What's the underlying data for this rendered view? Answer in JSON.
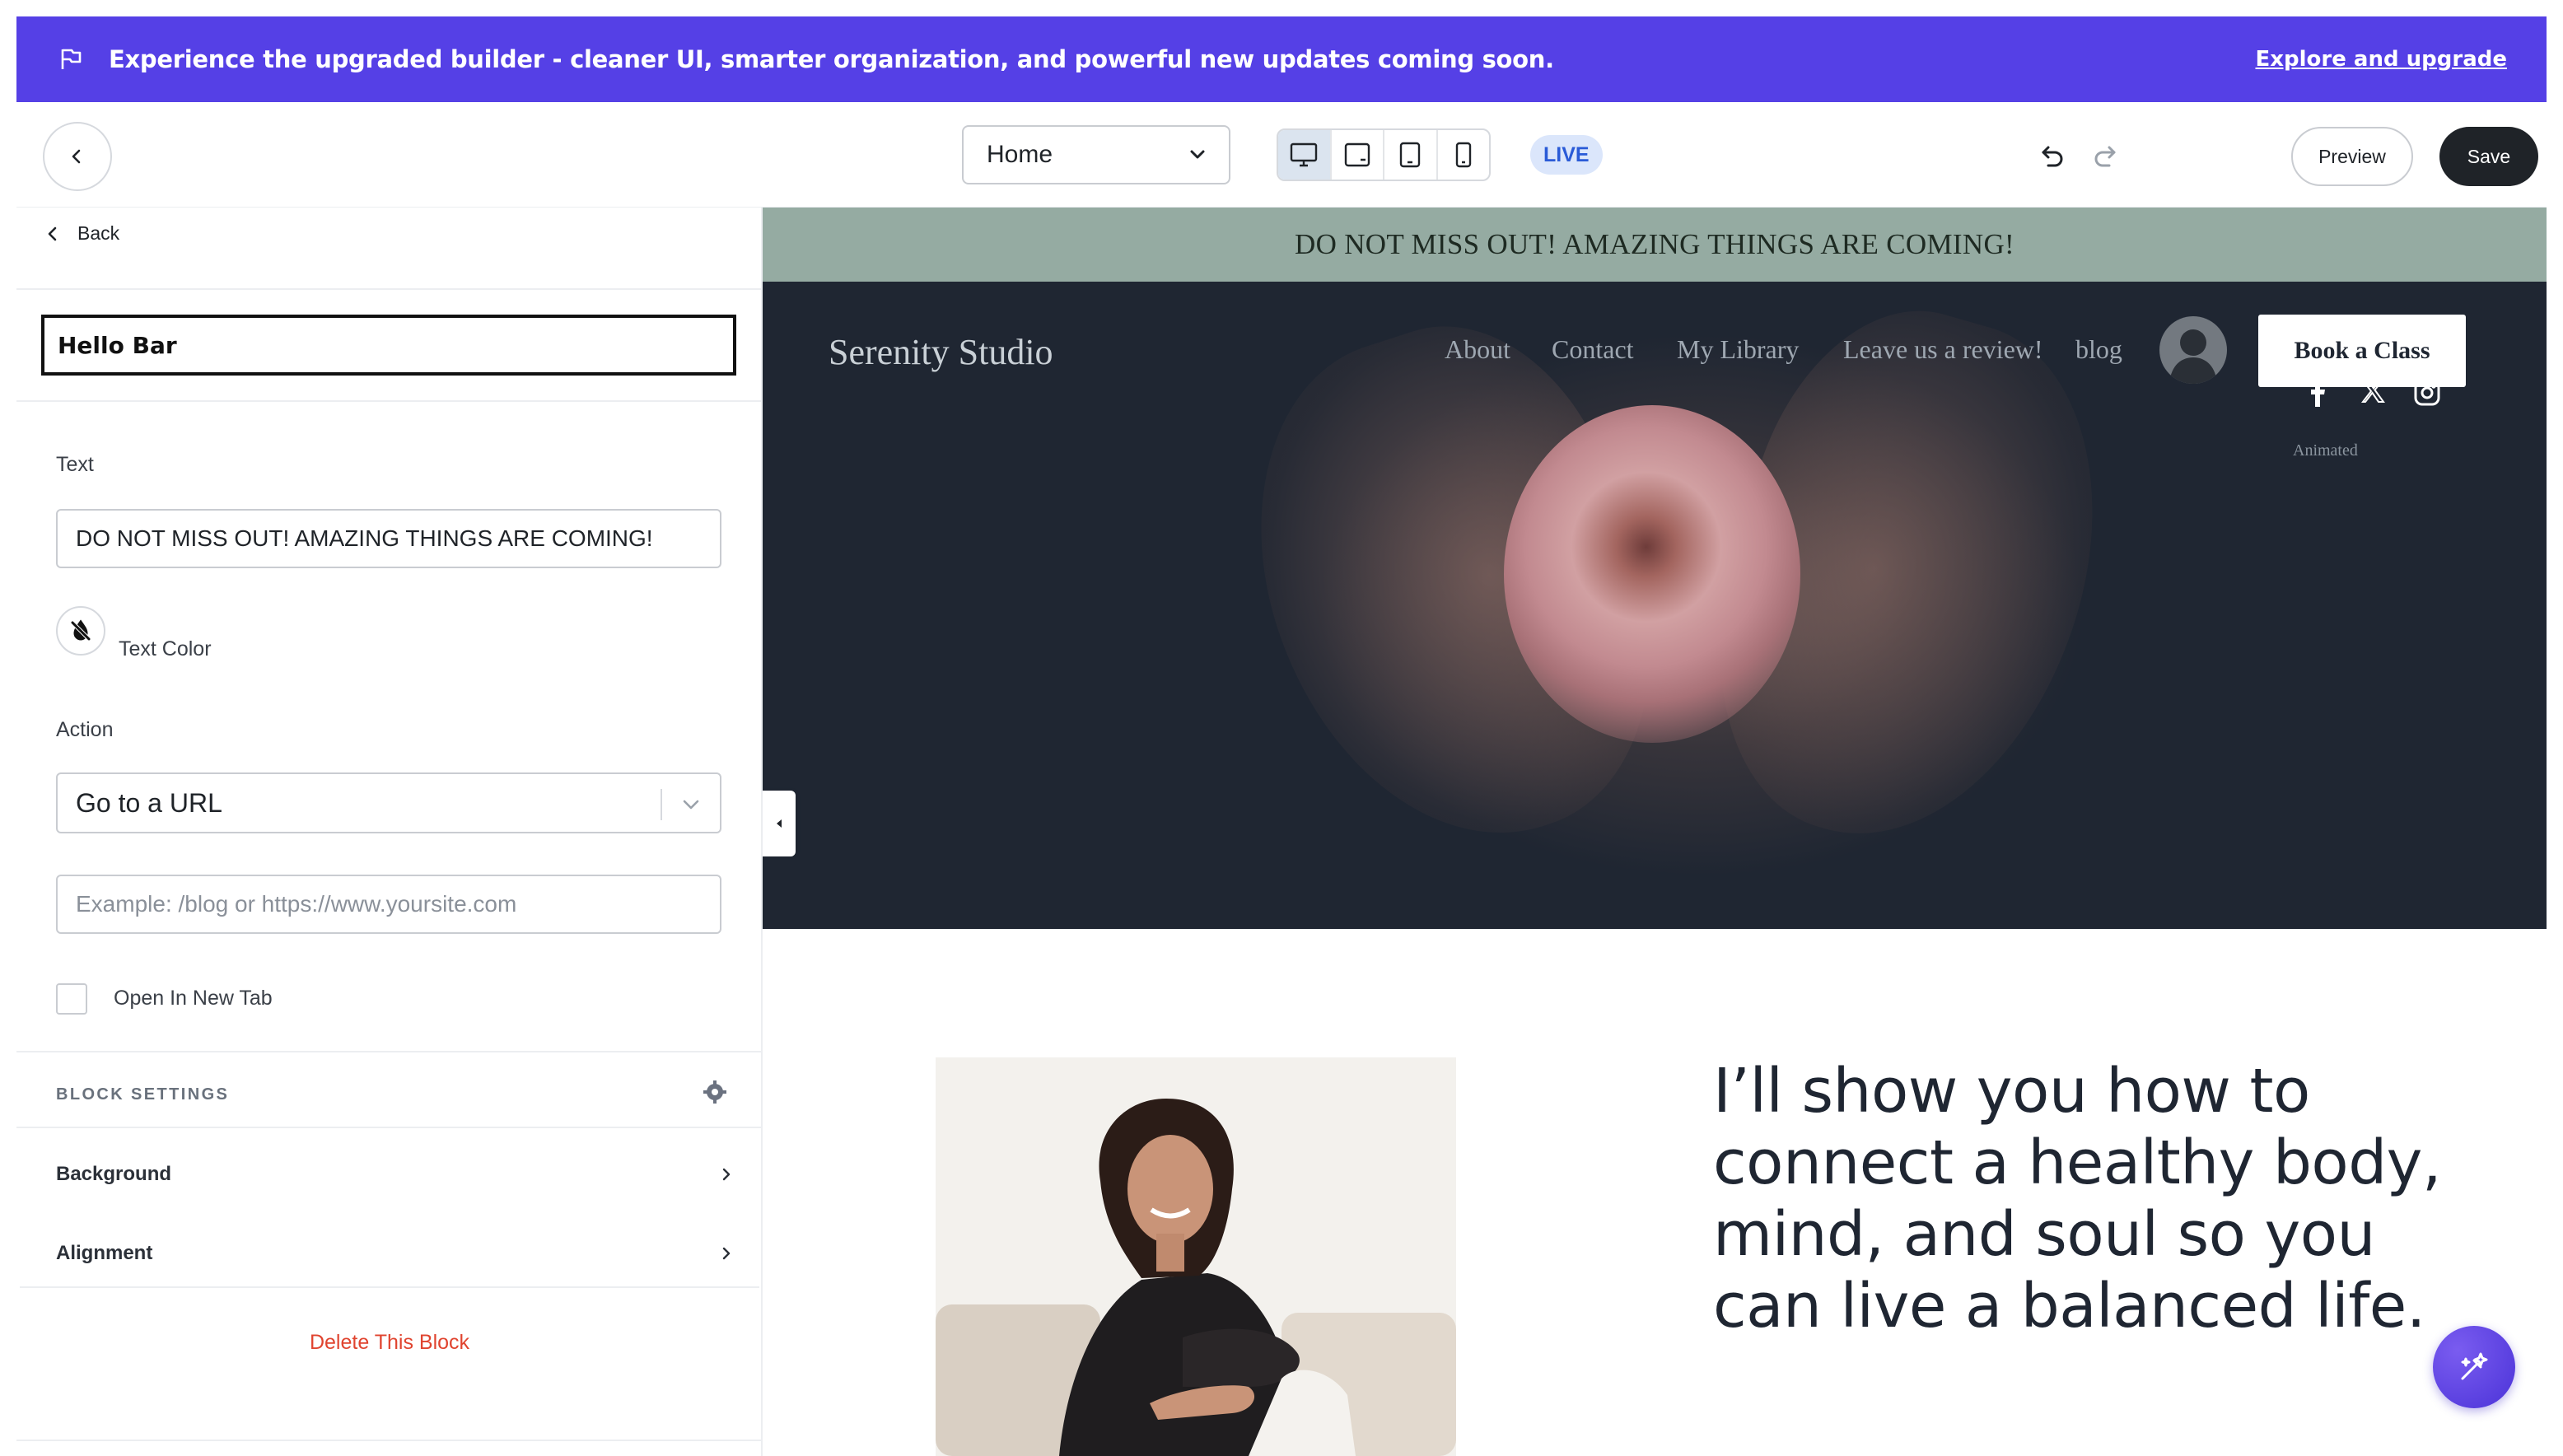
{
  "banner": {
    "message": "Experience the upgraded builder - cleaner UI, smarter organization, and powerful new updates coming soon.",
    "link": "Explore and upgrade",
    "background": "#5540e6",
    "icon": "flag-icon"
  },
  "toolbar": {
    "page_select": "Home",
    "devices": [
      "desktop-icon",
      "laptop-icon",
      "tablet-icon",
      "mobile-icon"
    ],
    "active_device": "desktop-icon",
    "status": "LIVE",
    "preview_label": "Preview",
    "save_label": "Save"
  },
  "sidebar": {
    "back_label": "Back",
    "block_title": "Hello Bar",
    "text_label": "Text",
    "text_value": "DO NOT MISS OUT! AMAZING THINGS ARE COMING!",
    "text_color_label": "Text Color",
    "action_label": "Action",
    "action_value": "Go to a URL",
    "url_placeholder": "Example: /blog or https://www.yoursite.com",
    "new_tab_label": "Open In New Tab",
    "new_tab_checked": false,
    "block_settings_label": "BLOCK SETTINGS",
    "rows": [
      "Background",
      "Alignment"
    ],
    "delete_label": "Delete This Block",
    "delete_color": "#e0442f"
  },
  "canvas": {
    "hello_bar": {
      "text": "DO NOT MISS OUT! AMAZING THINGS ARE COMING!",
      "background": "#95aba2"
    },
    "header": {
      "brand": "Serenity Studio",
      "nav": [
        "About",
        "Contact",
        "My Library",
        "Leave us a review!",
        "blog"
      ],
      "cta": "Book a Class",
      "social": [
        "facebook-icon",
        "x-icon",
        "instagram-icon"
      ],
      "social_caption": "Animated"
    },
    "headline": "I’ll show you how to connect a healthy body, mind, and soul so you can live a balanced life."
  }
}
